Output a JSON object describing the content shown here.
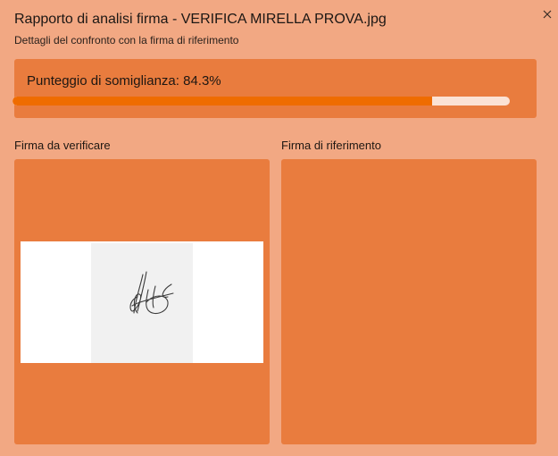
{
  "dialog": {
    "title": "Rapporto di analisi firma - VERIFICA MIRELLA PROVA.jpg",
    "subtitle": "Dettagli del confronto con la firma di riferimento",
    "close_icon": "close-icon"
  },
  "score": {
    "label": "Punteggio di somiglianza: 84.3%",
    "percent": 84.3,
    "fill_color": "#ef6c00",
    "track_color": "#fbe2d4"
  },
  "panels": {
    "verify_label": "Firma da verificare",
    "reference_label": "Firma di riferimento"
  },
  "colors": {
    "background": "#f2a883",
    "card": "#e97c3e"
  }
}
